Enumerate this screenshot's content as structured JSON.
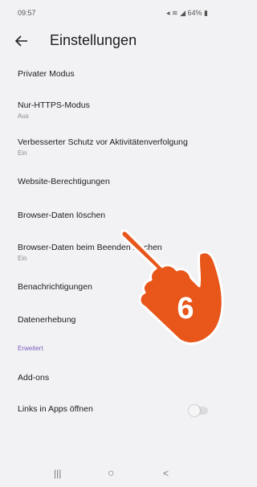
{
  "status_bar": {
    "time": "09:57",
    "battery": "64%"
  },
  "header": {
    "back_icon": "arrow-left-icon",
    "title": "Einstellungen"
  },
  "settings": [
    {
      "label": "Privater Modus"
    },
    {
      "label": "Nur-HTTPS-Modus",
      "sub": "Aus"
    },
    {
      "label": "Verbesserter Schutz vor Aktivitätenverfolgung",
      "sub": "Ein"
    },
    {
      "label": "Website-Berechtigungen"
    },
    {
      "label": "Browser-Daten löschen"
    },
    {
      "label": "Browser-Daten beim Beenden löschen",
      "sub": "Ein"
    },
    {
      "label": "Benachrichtigungen"
    },
    {
      "label": "Datenerhebung"
    }
  ],
  "advanced": {
    "header": "Erweitert",
    "items": [
      {
        "label": "Add-ons"
      },
      {
        "label": "Links in Apps öffnen",
        "toggle": false
      }
    ]
  },
  "overlay": {
    "step_number": "6",
    "color": "#e8561a"
  },
  "nav": {
    "recent": "|||",
    "home": "○",
    "back": "<"
  }
}
